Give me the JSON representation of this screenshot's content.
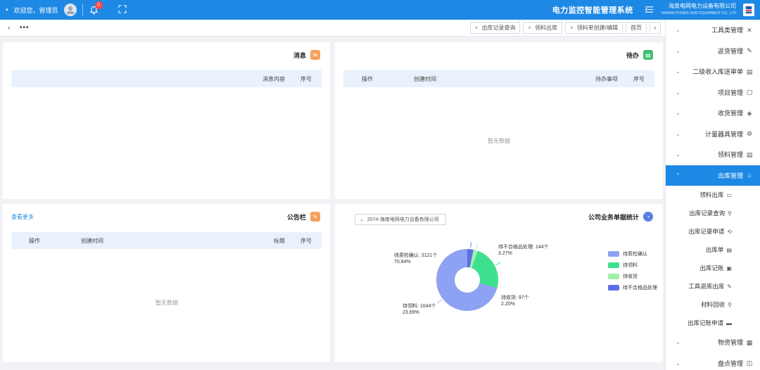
{
  "topbar": {
    "user_name": "欢迎您，管理员",
    "badge_count": "0",
    "system_title": "电力监控智能管理系统",
    "company_name": "海南电网电力设备有限公司",
    "company_sub": "HAINAN POWER GRID EQUIPMENT CO., LTD"
  },
  "tabstrip": {
    "more": "•••",
    "tabs": [
      {
        "label": "首页"
      },
      {
        "label": "领料单创建/编辑"
      },
      {
        "label": "领料出库"
      },
      {
        "label": "出库记录查询"
      }
    ]
  },
  "sidebar": {
    "items": [
      {
        "label": "工具类管理",
        "icon": "✕"
      },
      {
        "label": "返货管理",
        "icon": "✎"
      },
      {
        "label": "二级收入库送审单",
        "icon": "▤"
      },
      {
        "label": "项目管理",
        "icon": "▢"
      },
      {
        "label": "收货管理",
        "icon": "◈"
      },
      {
        "label": "计量器具管理",
        "icon": "⚙"
      },
      {
        "label": "领料管理",
        "icon": "▤"
      },
      {
        "label": "出库管理",
        "icon": "⌂"
      }
    ],
    "subitems": [
      {
        "label": "领料出库",
        "icon": "▭"
      },
      {
        "label": "出库记录查询",
        "icon": "⚲"
      },
      {
        "label": "出库记录申请",
        "icon": "⟲"
      },
      {
        "label": "出库单",
        "icon": "▤"
      },
      {
        "label": "出库记账",
        "icon": "▣"
      },
      {
        "label": "工具退库出库",
        "icon": "✎"
      },
      {
        "label": "材料回收",
        "icon": "⚲"
      },
      {
        "label": "出库记账申请",
        "icon": "▬"
      }
    ],
    "bottom": [
      {
        "label": "物资管理",
        "icon": "▦"
      },
      {
        "label": "盘点管理",
        "icon": "◫"
      }
    ]
  },
  "todo_panel": {
    "title": "待办",
    "cols": {
      "no": "序号",
      "task": "待办事项",
      "time": "创建时间",
      "op": "操作"
    },
    "empty": "暂无数据"
  },
  "message_panel": {
    "title": "消息",
    "cols": {
      "no": "序号",
      "content": "消息内容"
    },
    "empty": ""
  },
  "stats_panel": {
    "title": "公司业务单据统计",
    "select_value": "2074-海南电网电力设备有限公司"
  },
  "notice_panel": {
    "title": "公告栏",
    "more": "查看更多",
    "cols": {
      "no": "序号",
      "title": "标题",
      "time": "创建时间",
      "op": "操作"
    },
    "empty": "暂无数据"
  },
  "chart_data": {
    "type": "pie",
    "donut": true,
    "slices": [
      {
        "name": "待不合格品处理",
        "count": 144,
        "percent": 3.27,
        "color": "#5b6fe6",
        "label": "待不合格品处理: 144个\n3.27%"
      },
      {
        "name": "待收货",
        "count": 97,
        "percent": 2.2,
        "color": "#a0f0a8",
        "label": "待收货: 97个\n2.20%"
      },
      {
        "name": "待领料",
        "count": 1044,
        "percent": 23.69,
        "color": "#3ee08f",
        "label": "待领料: 1044个\n23.69%"
      },
      {
        "name": "待质检确认",
        "count": 3121,
        "percent": 70.84,
        "color": "#8ea2f3",
        "label": "待质检确认: 3121个\n70.84%"
      }
    ],
    "legend": [
      {
        "name": "待质检确认",
        "color": "#8ea2f3"
      },
      {
        "name": "待领料",
        "color": "#3ee08f"
      },
      {
        "name": "待收货",
        "color": "#a0f0a8"
      },
      {
        "name": "待不合格品处理",
        "color": "#5b6fe6"
      }
    ],
    "legend_position": "left"
  }
}
